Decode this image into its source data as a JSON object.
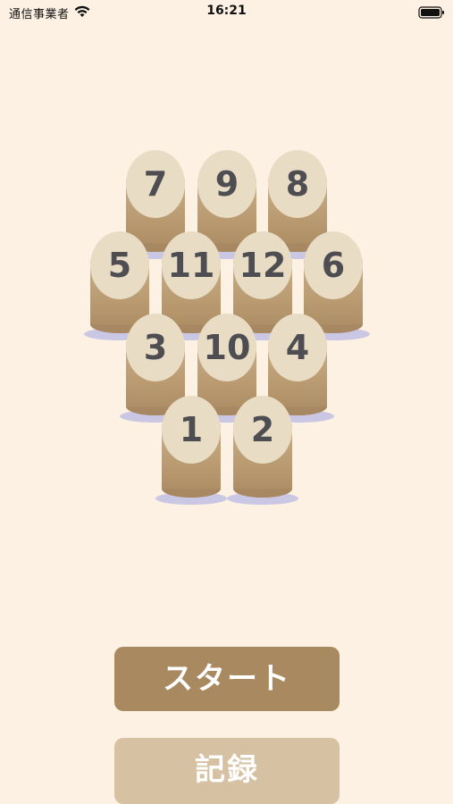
{
  "status_bar": {
    "carrier": "通信事業者",
    "time": "16:21",
    "wifi_icon": "wifi-icon",
    "battery_icon": "battery-icon"
  },
  "pins": [
    {
      "number": "7"
    },
    {
      "number": "9"
    },
    {
      "number": "8"
    },
    {
      "number": "5"
    },
    {
      "number": "11"
    },
    {
      "number": "12"
    },
    {
      "number": "6"
    },
    {
      "number": "3"
    },
    {
      "number": "10"
    },
    {
      "number": "4"
    },
    {
      "number": "1"
    },
    {
      "number": "2"
    }
  ],
  "buttons": {
    "start_label": "スタート",
    "record_label": "記録"
  },
  "colors": {
    "background": "#fdf1e3",
    "pin_top": "#e9dcc4",
    "pin_body": "#b99a70",
    "pin_shadow": "#c9c7e4",
    "start_button": "#a98a60",
    "record_button": "#d6c1a3",
    "number_text": "#4e4e52"
  }
}
